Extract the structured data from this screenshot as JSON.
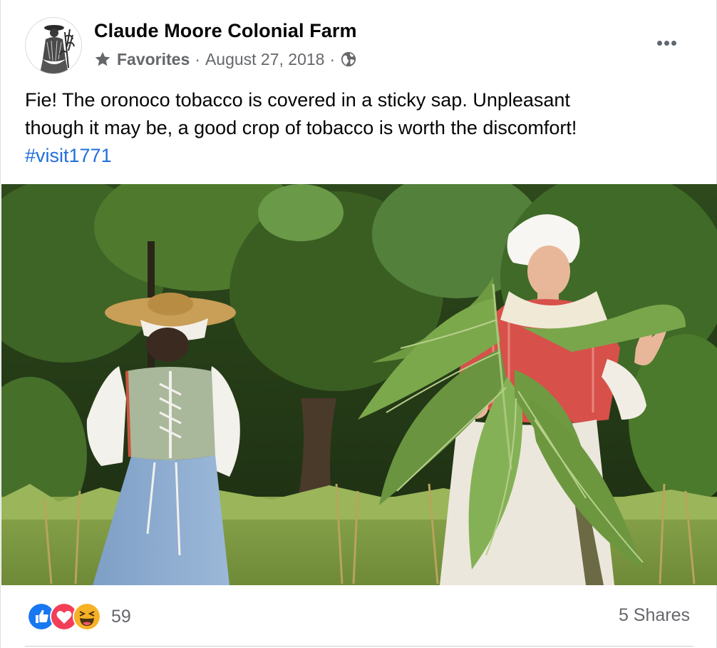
{
  "post": {
    "page_name": "Claude Moore Colonial Farm",
    "audience_label": "Favorites",
    "separator": "·",
    "date": "August 27, 2018",
    "icons": {
      "star": "star-icon",
      "privacy": "globe-icon",
      "more": "more-options-icon"
    },
    "text_line_1": "Fie! The oronoco tobacco is covered in a sticky sap. Unpleasant",
    "text_line_2": "though it may be, a good crop of tobacco is worth the discomfort!",
    "hashtag": "#visit1771"
  },
  "photo": {
    "alt": "Two women in colonial dress in a field; one holds large tobacco leaves"
  },
  "footer": {
    "reactions": [
      "like",
      "love",
      "haha"
    ],
    "reaction_count": "59",
    "shares": "5 Shares"
  },
  "colors": {
    "link": "#216fdb",
    "secondary_text": "#65676b",
    "like_blue": "#1877f2",
    "love_red": "#f33e58",
    "haha_yellow": "#f7b125"
  }
}
